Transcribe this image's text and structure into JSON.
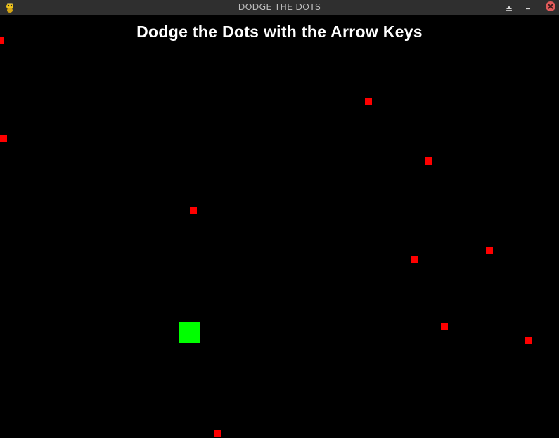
{
  "window": {
    "title": "DODGE THE DOTS"
  },
  "titlebar_icons": {
    "app": "pygame-snake-icon",
    "shade": "eject-up-triangle-icon",
    "minimize": "minimize-dash-icon",
    "close": "close-x-circle-icon"
  },
  "game": {
    "title": "Dodge the Dots with the Arrow Keys",
    "background_color": "#000000",
    "dot_color": "#ff0000",
    "player_color": "#00ff00"
  },
  "colors": {
    "titlebar_bg": "#2f2f2f",
    "title_text": "#bdbdbd",
    "close_button": "#e05a5a"
  }
}
